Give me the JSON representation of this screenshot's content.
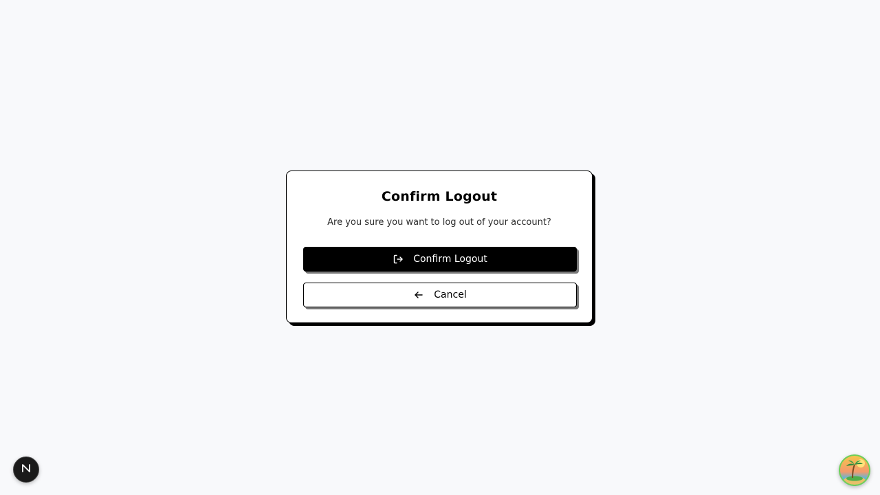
{
  "modal": {
    "title": "Confirm Logout",
    "message": "Are you sure you want to log out of your account?",
    "confirm_label": "Confirm Logout",
    "cancel_label": "Cancel",
    "confirm_icon": "logout-icon",
    "cancel_icon": "arrow-left-icon"
  },
  "corner_widgets": {
    "dev_badge_icon": "nextjs-logo-icon",
    "avatar_icon": "island-avatar-icon"
  },
  "colors": {
    "background": "#f8f9fb",
    "primary_button": "#000000",
    "border": "#000000"
  }
}
